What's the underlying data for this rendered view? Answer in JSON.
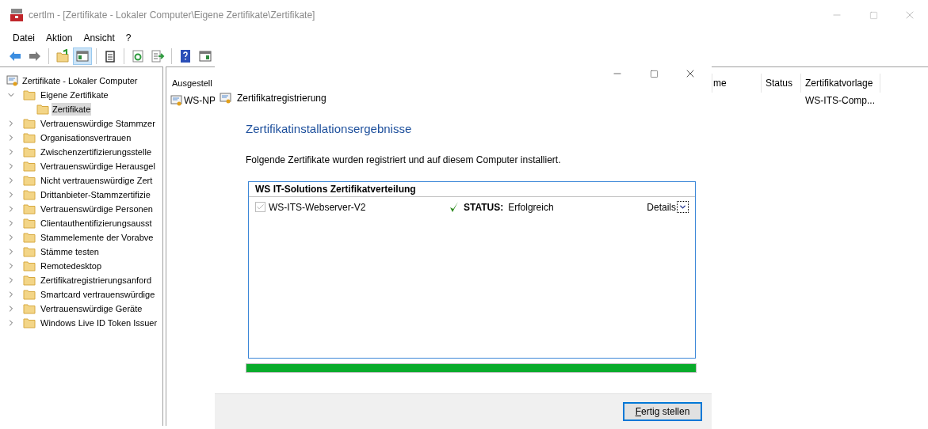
{
  "window": {
    "title": "certlm - [Zertifikate - Lokaler Computer\\Eigene Zertifikate\\Zertifikate]"
  },
  "menu": [
    "Datei",
    "Aktion",
    "Ansicht",
    "?"
  ],
  "toolbar": [
    {
      "kind": "back",
      "pressed": false
    },
    {
      "kind": "forward",
      "pressed": false
    },
    {
      "kind": "sep"
    },
    {
      "kind": "up",
      "pressed": false
    },
    {
      "kind": "tree",
      "pressed": true
    },
    {
      "kind": "sep"
    },
    {
      "kind": "clipboard",
      "pressed": false
    },
    {
      "kind": "sep"
    },
    {
      "kind": "refresh",
      "pressed": false
    },
    {
      "kind": "export",
      "pressed": false
    },
    {
      "kind": "sep"
    },
    {
      "kind": "help",
      "pressed": false
    },
    {
      "kind": "panel",
      "pressed": false
    }
  ],
  "tree": {
    "root": "Zertifikate - Lokaler Computer",
    "children": [
      {
        "label": "Eigene Zertifikate",
        "expanded": true,
        "selected": false,
        "children": [
          {
            "label": "Zertifikate",
            "selected": true
          }
        ]
      },
      {
        "label": "Vertrauenswürdige Stammzer",
        "expanded": false,
        "selected": false
      },
      {
        "label": "Organisationsvertrauen",
        "expanded": false,
        "selected": false
      },
      {
        "label": "Zwischenzertifizierungsstelle",
        "expanded": false,
        "selected": false
      },
      {
        "label": "Vertrauenswürdige Herausgel",
        "expanded": false,
        "selected": false
      },
      {
        "label": "Nicht vertrauenswürdige Zert",
        "expanded": false,
        "selected": false
      },
      {
        "label": "Drittanbieter-Stammzertifizie",
        "expanded": false,
        "selected": false
      },
      {
        "label": "Vertrauenswürdige Personen",
        "expanded": false,
        "selected": false
      },
      {
        "label": "Clientauthentifizierungsausst",
        "expanded": false,
        "selected": false
      },
      {
        "label": "Stammelemente der Vorabve",
        "expanded": false,
        "selected": false
      },
      {
        "label": "Stämme testen",
        "expanded": false,
        "selected": false
      },
      {
        "label": "Remotedesktop",
        "expanded": false,
        "selected": false
      },
      {
        "label": "Zertifikatregistrierungsanford",
        "expanded": false,
        "selected": false
      },
      {
        "label": "Smartcard vertrauenswürdige",
        "expanded": false,
        "selected": false
      },
      {
        "label": "Vertrauenswürdige Geräte",
        "expanded": false,
        "selected": false
      },
      {
        "label": "Windows Live ID Token Issuer",
        "expanded": false,
        "selected": false
      }
    ]
  },
  "list": {
    "columns": [
      "Ausgestell",
      "me",
      "Status",
      "Zertifikatvorlage"
    ],
    "rows": [
      [
        "WS-NP",
        "",
        "",
        "WS-ITS-Comp..."
      ]
    ]
  },
  "dialog": {
    "header": "Zertifikatregistrierung",
    "heading": "Zertifikatinstallationsergebnisse",
    "description": "Folgende Zertifikate wurden registriert und auf diesem Computer installiert.",
    "group": {
      "title": "WS IT-Solutions Zertifikatverteilung",
      "items": [
        {
          "name": "WS-ITS-Webserver-V2",
          "checked": true,
          "disabled": true,
          "status_label": "STATUS:",
          "status": "Erfolgreich",
          "details": "Details"
        }
      ]
    },
    "progress": {
      "level": 1
    },
    "button": "Fertig stellen"
  }
}
